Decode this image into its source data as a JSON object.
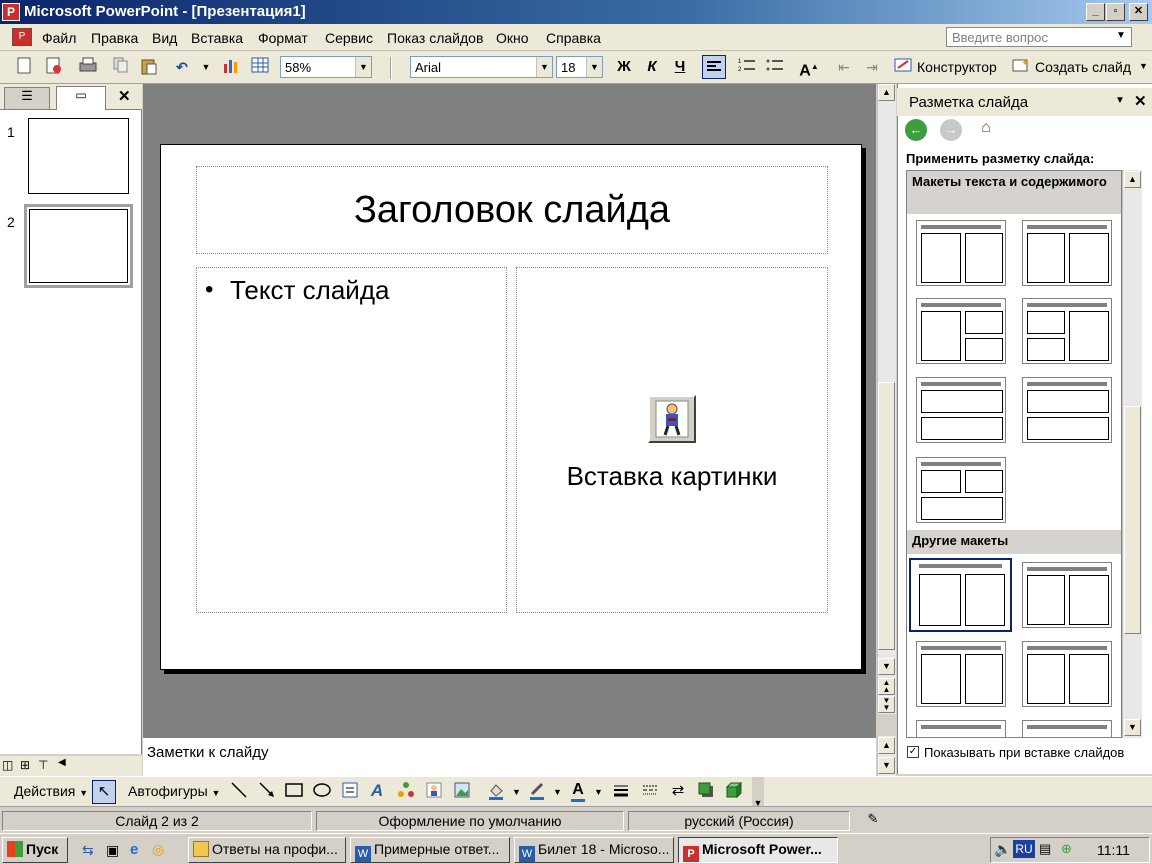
{
  "window": {
    "title": "Microsoft PowerPoint - [Презентация1]",
    "min_btn": "_",
    "restore_btn": "▫",
    "close_btn": "✕"
  },
  "menu": {
    "items": [
      "Файл",
      "Правка",
      "Вид",
      "Вставка",
      "Формат",
      "Сервис",
      "Показ слайдов",
      "Окно",
      "Справка"
    ],
    "ask_placeholder": "Введите вопрос"
  },
  "toolbar": {
    "zoom": "58%",
    "font": "Arial",
    "font_size": "18",
    "bold": "Ж",
    "italic": "К",
    "underline": "Ч",
    "designer": "Конструктор",
    "new_slide": "Создать слайд"
  },
  "slides_pane": {
    "close": "✕",
    "thumbs": [
      {
        "num": "1"
      },
      {
        "num": "2"
      }
    ]
  },
  "slide": {
    "title": "Заголовок слайда",
    "bullet": "•",
    "body_text": "Текст слайда",
    "clipart_label": "Вставка картинки"
  },
  "notes": {
    "text": "Заметки к слайду"
  },
  "task_pane": {
    "title": "Разметка слайда",
    "apply_label": "Применить разметку слайда:",
    "section1": "Макеты текста и содержимого",
    "section2": "Другие макеты",
    "checkbox_label": "Показывать при вставке слайдов",
    "checkbox_checked": true
  },
  "drawing_toolbar": {
    "actions": "Действия",
    "autoshapes": "Автофигуры"
  },
  "status": {
    "slide": "Слайд 2 из 2",
    "design": "Оформление по умолчанию",
    "language": "русский (Россия)"
  },
  "taskbar": {
    "start": "Пуск",
    "buttons": [
      "Ответы на профи...",
      "Примерные ответ...",
      "Билет 18 - Microso...",
      "Microsoft Power..."
    ],
    "lang": "RU",
    "clock": "11:11"
  }
}
